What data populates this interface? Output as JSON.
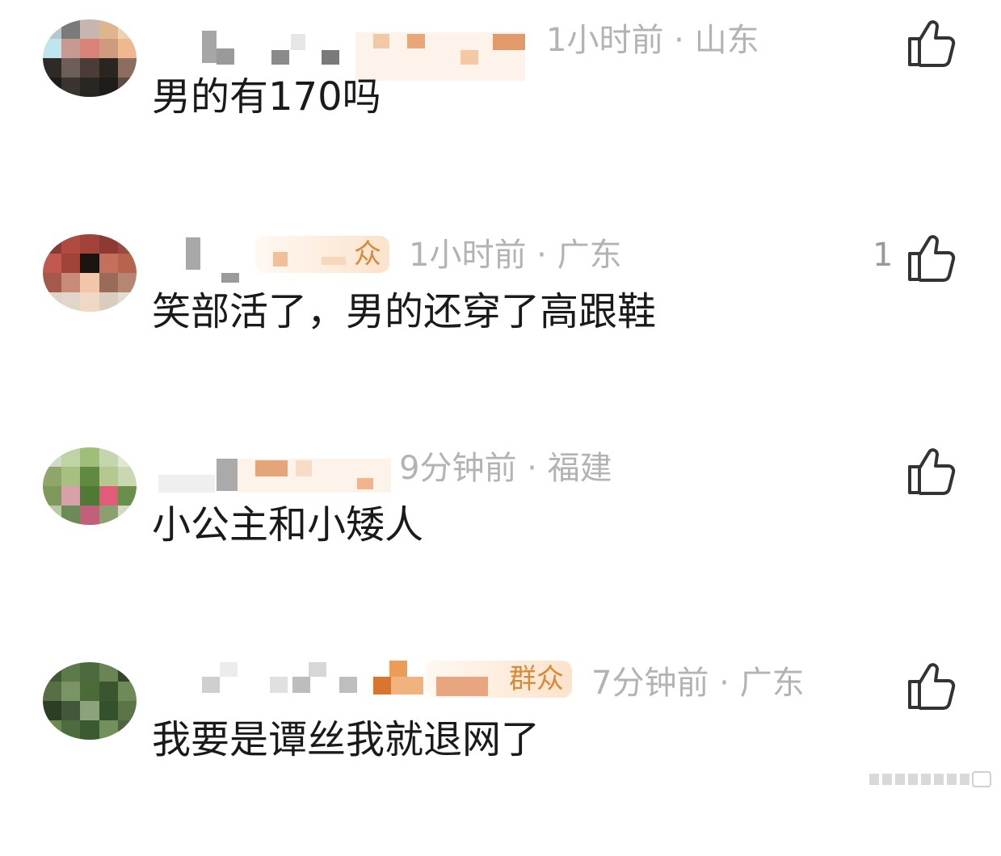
{
  "comments": [
    {
      "username": "",
      "badge": "",
      "time": "1小时前",
      "location": "山东",
      "separator": "·",
      "likes": "",
      "text": "男的有170吗",
      "avatar_colors": [
        "#b6c8cf",
        "#7a7a7a",
        "#c7b6b0",
        "#e0b48c",
        "#eed2b0",
        "#bfe6ef",
        "#c79a91",
        "#d9827a",
        "#cf9a7d",
        "#f0b890",
        "#2d2a28",
        "#6d5e57",
        "#4a3c36",
        "#2b2522",
        "#8c6e5f",
        "#1c1c1c",
        "#3a3330",
        "#2a2623",
        "#1f1c1a",
        "#5a4b43"
      ]
    },
    {
      "username": "",
      "badge": "众",
      "time": "1小时前",
      "location": "广东",
      "separator": "·",
      "likes": "1",
      "text": "笑部活了，男的还穿了高跟鞋",
      "avatar_colors": [
        "#8a3a34",
        "#b04b42",
        "#a2433b",
        "#8e3a33",
        "#9a4a40",
        "#c05a4e",
        "#a04338",
        "#1a1412",
        "#c4705c",
        "#b7644f",
        "#a45a4a",
        "#c88b78",
        "#f2c6a8",
        "#9a6b58",
        "#b58672",
        "#dfd3c7",
        "#e2d6ca",
        "#f0d8c4",
        "#d9cdc0",
        "#e4dbd1"
      ]
    },
    {
      "username": "",
      "badge": "",
      "time": "9分钟前",
      "location": "福建",
      "separator": "·",
      "likes": "",
      "text": "小公主和小矮人",
      "avatar_colors": [
        "#d3d9c8",
        "#bfd3a4",
        "#9fbf78",
        "#c4d6b0",
        "#e0e6d4",
        "#8ea66a",
        "#a7c07f",
        "#5f8a42",
        "#b4c890",
        "#c9d8b0",
        "#7d9a5a",
        "#d8a0a8",
        "#4e7a36",
        "#e25c7a",
        "#6a8f4a",
        "#b9c7a6",
        "#6b8a58",
        "#c0607a",
        "#8aa06e",
        "#d2dac6"
      ]
    },
    {
      "username": "",
      "badge": "群众",
      "time": "7分钟前",
      "location": "广东",
      "separator": "·",
      "likes": "",
      "text": "我要是谭丝我就退网了",
      "avatar_colors": [
        "#3f5a33",
        "#5d7a4a",
        "#4c6a3d",
        "#6b8454",
        "#2f4728",
        "#566f45",
        "#7a9465",
        "#4a6a38",
        "#3a5530",
        "#6e8a58",
        "#2c3f25",
        "#41593a",
        "#8ca27a",
        "#35502c",
        "#5b7448",
        "#6a8a50",
        "#4e6b40",
        "#3c5a32",
        "#73905c",
        "#4b6540"
      ]
    }
  ],
  "icons": {
    "like": "thumbs-up-icon"
  },
  "colors": {
    "text": "#1a1a1a",
    "meta": "#b3b3b3",
    "badge_text": "#d9893a",
    "badge_bg": "#fbe3cc"
  }
}
